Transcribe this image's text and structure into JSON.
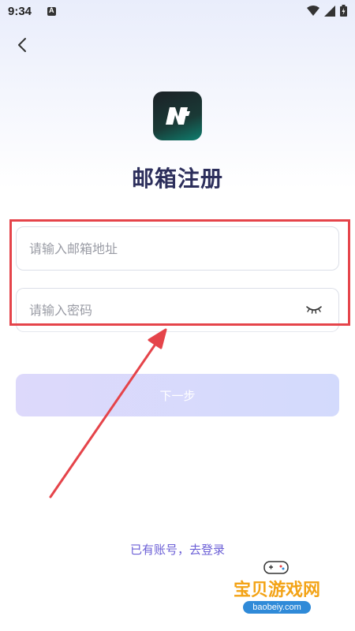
{
  "status_bar": {
    "time": "9:34",
    "battery_icon": "battery-icon",
    "wifi_icon": "wifi-icon",
    "signal_icon": "signal-icon"
  },
  "header": {
    "back_icon": "chevron-left-icon"
  },
  "title": "邮箱注册",
  "email_field": {
    "placeholder": "请输入邮箱地址",
    "value": ""
  },
  "password_field": {
    "placeholder": "请输入密码",
    "value": "",
    "toggle_icon": "eye-closed-icon"
  },
  "next_button": {
    "label": "下一步"
  },
  "login_link": {
    "label": "已有账号，去登录"
  },
  "watermark": {
    "text": "宝贝游戏网",
    "url": "baobeiy.com"
  },
  "colors": {
    "accent": "#6b5fd6",
    "title": "#2d2f5c",
    "highlight": "#e5444a",
    "button_start": "#ddd9fb",
    "button_end": "#d3dafc"
  }
}
